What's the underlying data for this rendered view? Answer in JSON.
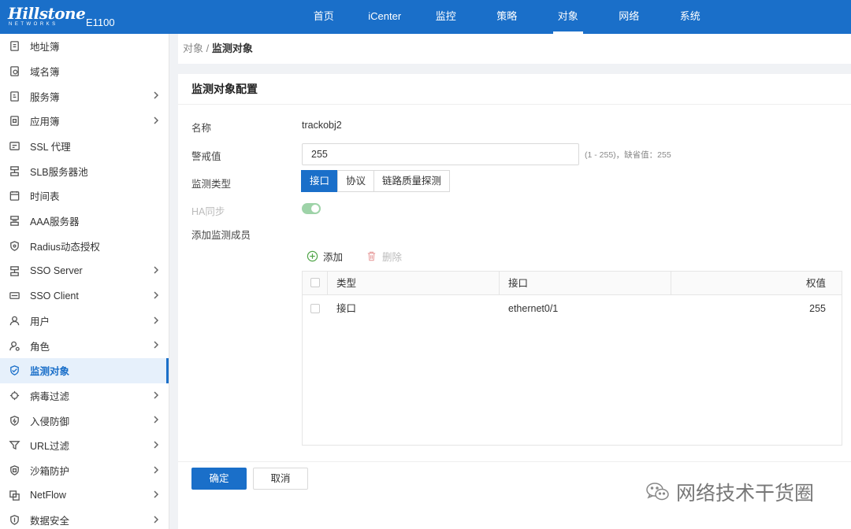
{
  "brand": {
    "logo": "Hillstone",
    "logo_sub": "NETWORKS",
    "model": "E1100"
  },
  "nav": [
    {
      "label": "首页",
      "active": false
    },
    {
      "label": "iCenter",
      "active": false
    },
    {
      "label": "监控",
      "active": false
    },
    {
      "label": "策略",
      "active": false
    },
    {
      "label": "对象",
      "active": true
    },
    {
      "label": "网络",
      "active": false
    },
    {
      "label": "系统",
      "active": false
    }
  ],
  "sidebar": {
    "items": [
      {
        "label": "地址簿",
        "icon": "address-book-icon",
        "chevron": false
      },
      {
        "label": "域名簿",
        "icon": "domain-book-icon",
        "chevron": false
      },
      {
        "label": "服务簿",
        "icon": "service-book-icon",
        "chevron": true
      },
      {
        "label": "应用簿",
        "icon": "app-book-icon",
        "chevron": true
      },
      {
        "label": "SSL 代理",
        "icon": "ssl-proxy-icon",
        "chevron": false
      },
      {
        "label": "SLB服务器池",
        "icon": "slb-pool-icon",
        "chevron": false
      },
      {
        "label": "时间表",
        "icon": "calendar-icon",
        "chevron": false
      },
      {
        "label": "AAA服务器",
        "icon": "aaa-server-icon",
        "chevron": false
      },
      {
        "label": "Radius动态授权",
        "icon": "shield-icon",
        "chevron": false
      },
      {
        "label": "SSO Server",
        "icon": "sso-server-icon",
        "chevron": true
      },
      {
        "label": "SSO Client",
        "icon": "sso-client-icon",
        "chevron": true
      },
      {
        "label": "用户",
        "icon": "user-icon",
        "chevron": true
      },
      {
        "label": "角色",
        "icon": "role-icon",
        "chevron": true
      },
      {
        "label": "监测对象",
        "icon": "monitor-shield-icon",
        "chevron": false,
        "active": true
      },
      {
        "label": "病毒过滤",
        "icon": "virus-icon",
        "chevron": true
      },
      {
        "label": "入侵防御",
        "icon": "intrusion-shield-icon",
        "chevron": true
      },
      {
        "label": "URL过滤",
        "icon": "filter-icon",
        "chevron": true
      },
      {
        "label": "沙箱防护",
        "icon": "sandbox-shield-icon",
        "chevron": true
      },
      {
        "label": "NetFlow",
        "icon": "netflow-icon",
        "chevron": true
      },
      {
        "label": "数据安全",
        "icon": "data-security-icon",
        "chevron": true
      }
    ]
  },
  "breadcrumb": {
    "parent": "对象 /",
    "current": "监测对象"
  },
  "panel": {
    "title": "监测对象配置",
    "name_label": "名称",
    "name_value": "trackobj2",
    "threshold_label": "警戒值",
    "threshold_value": "255",
    "threshold_hint": "(1 - 255)，缺省值：255",
    "type_label": "监测类型",
    "type_options": [
      {
        "label": "接口",
        "selected": true
      },
      {
        "label": "协议",
        "selected": false
      },
      {
        "label": "链路质量探测",
        "selected": false
      }
    ],
    "ha_label": "HA同步",
    "ha_on": true,
    "members_label": "添加监测成员",
    "add_label": "添加",
    "delete_label": "删除"
  },
  "table": {
    "columns": [
      "类型",
      "接口",
      "权值"
    ],
    "rows": [
      {
        "type": "接口",
        "interface": "ethernet0/1",
        "weight": "255"
      }
    ]
  },
  "buttons": {
    "ok": "确定",
    "cancel": "取消"
  },
  "watermark": "网络技术干货圈",
  "colors": {
    "primary": "#1a6fc9",
    "toggle": "#9ed3a8",
    "add_icon": "#52a64a",
    "delete_icon": "#e8a0a0"
  }
}
